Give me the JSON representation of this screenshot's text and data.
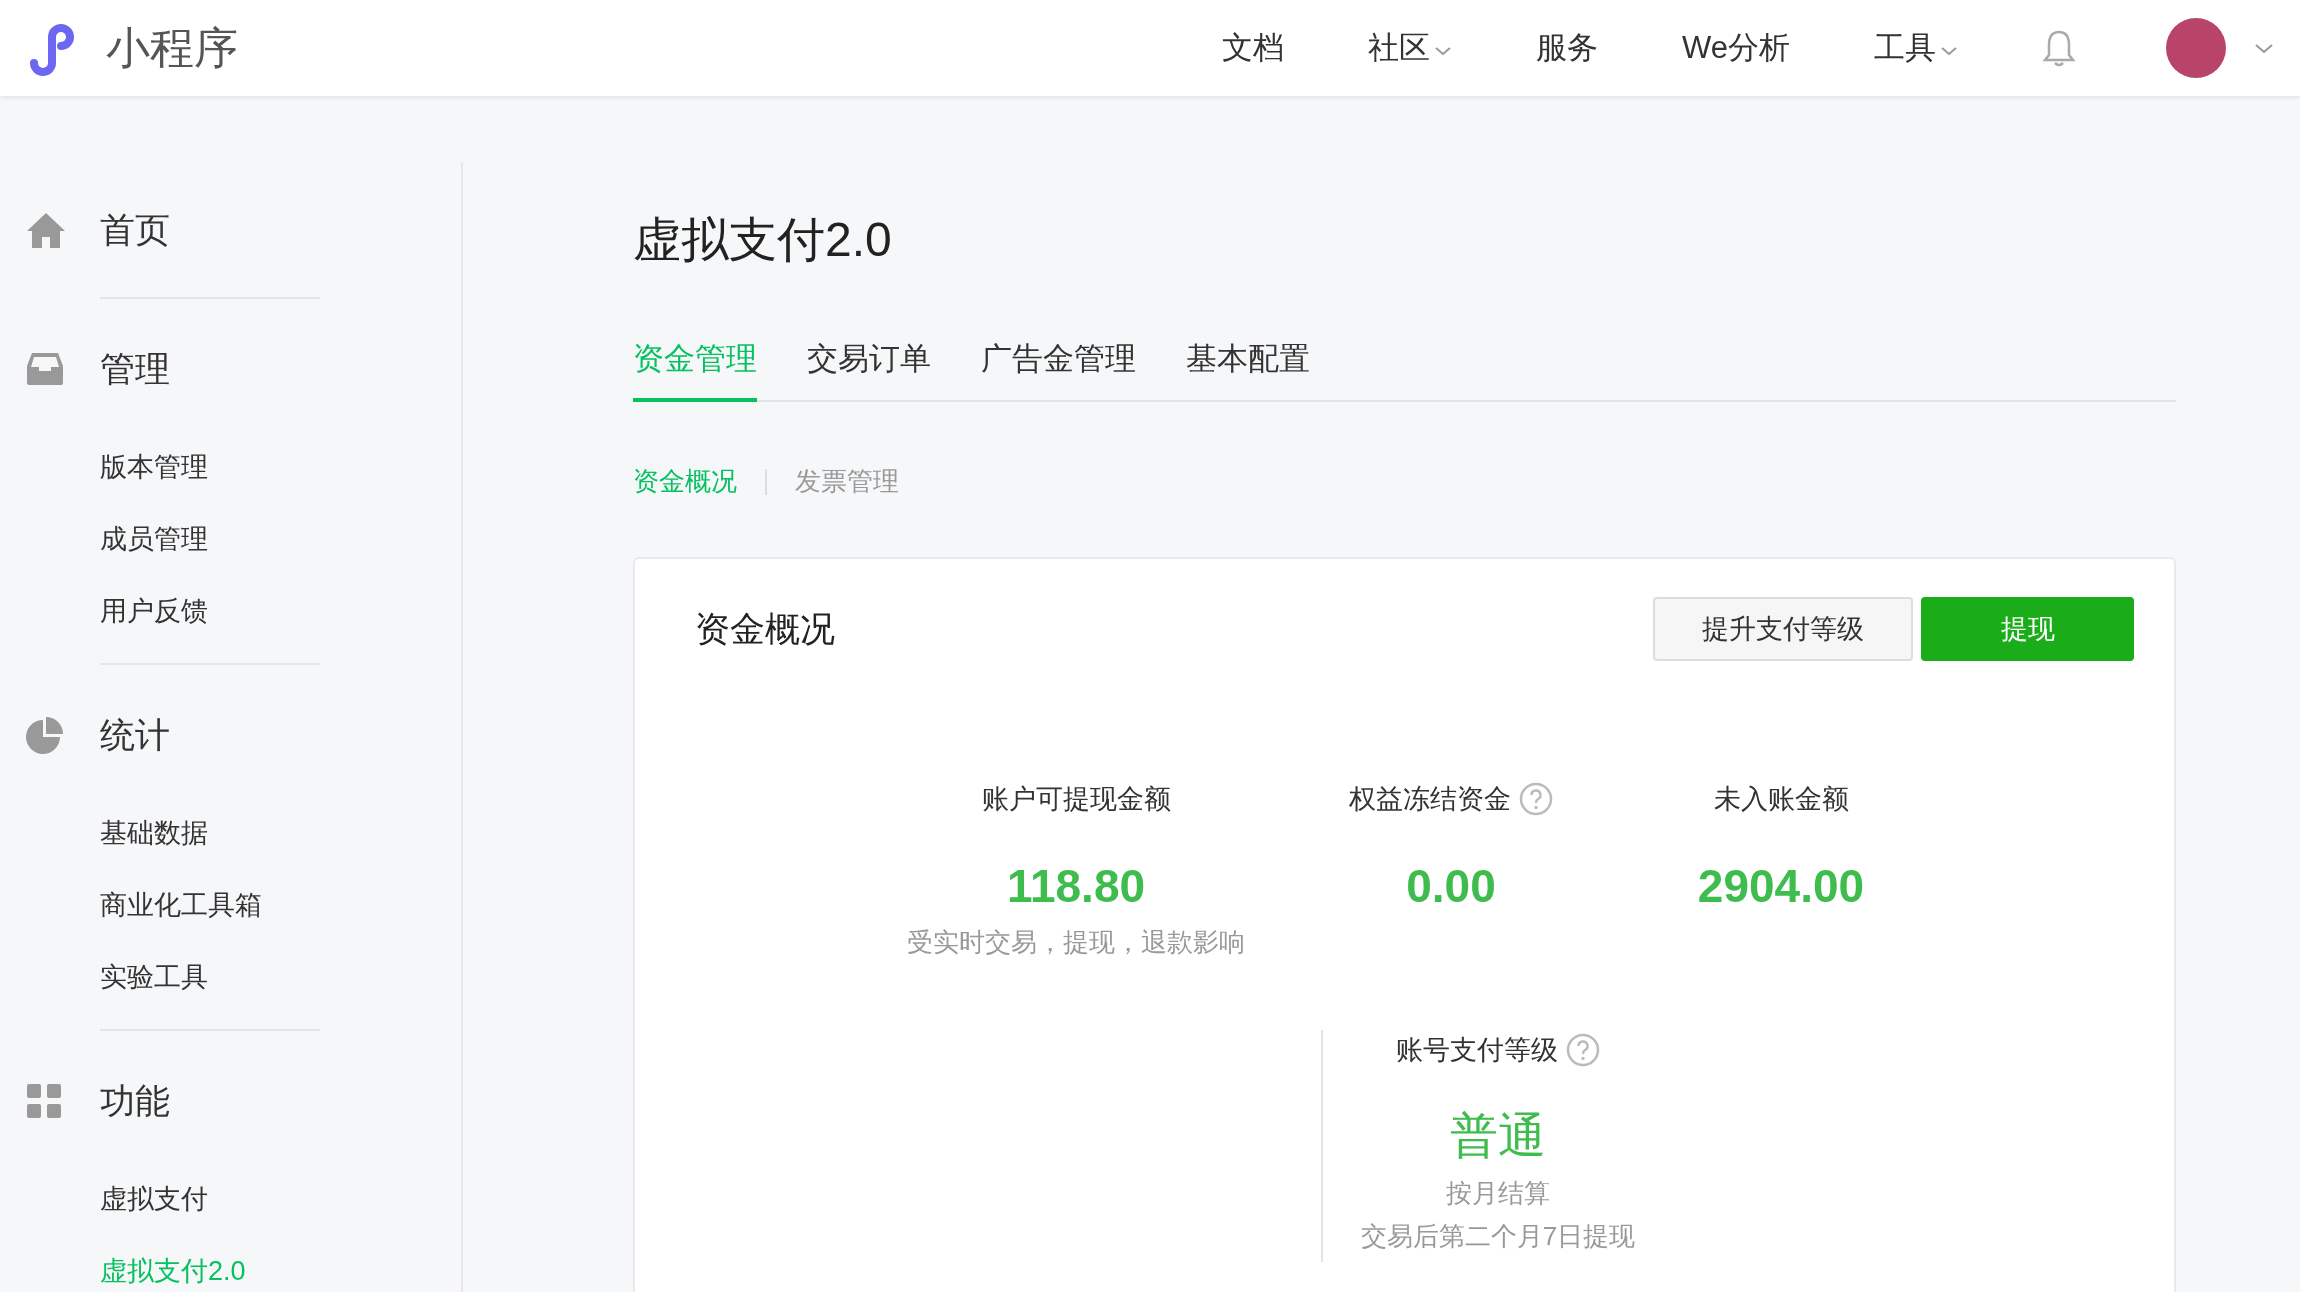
{
  "header": {
    "logo_text": "小程序",
    "nav": [
      {
        "label": "文档",
        "has_menu": false
      },
      {
        "label": "社区",
        "has_menu": true
      },
      {
        "label": "服务",
        "has_menu": false
      },
      {
        "label": "We分析",
        "has_menu": false
      },
      {
        "label": "工具",
        "has_menu": true
      }
    ]
  },
  "sidebar": {
    "sections": [
      {
        "title": "首页"
      },
      {
        "title": "管理",
        "items": [
          {
            "label": "版本管理",
            "selected": false
          },
          {
            "label": "成员管理",
            "selected": false
          },
          {
            "label": "用户反馈",
            "selected": false
          }
        ]
      },
      {
        "title": "统计",
        "items": [
          {
            "label": "基础数据",
            "selected": false
          },
          {
            "label": "商业化工具箱",
            "selected": false
          },
          {
            "label": "实验工具",
            "selected": false
          }
        ]
      },
      {
        "title": "功能",
        "items": [
          {
            "label": "虚拟支付",
            "selected": false
          },
          {
            "label": "虚拟支付2.0",
            "selected": true
          }
        ]
      }
    ]
  },
  "page_title": "虚拟支付2.0",
  "tabs": [
    {
      "label": "资金管理",
      "selected": true
    },
    {
      "label": "交易订单",
      "selected": false
    },
    {
      "label": "广告金管理",
      "selected": false
    },
    {
      "label": "基本配置",
      "selected": false
    }
  ],
  "subtabs": [
    {
      "label": "资金概况",
      "selected": true
    },
    {
      "label": "发票管理",
      "selected": false
    }
  ],
  "card": {
    "title": "资金概况",
    "buttons": [
      {
        "label": "提升支付等级",
        "kind": "secondary"
      },
      {
        "label": "提现",
        "kind": "primary"
      }
    ],
    "stats": [
      {
        "label": "账户可提现金额",
        "help": false,
        "value": "118.80",
        "note": "受实时交易，提现，退款影响"
      },
      {
        "label": "权益冻结资金",
        "help": true,
        "value": "0.00"
      },
      {
        "label": "未入账金额",
        "help": false,
        "value": "2904.00"
      }
    ],
    "level": {
      "label": "账号支付等级",
      "help": true,
      "value": "普通",
      "notes": [
        "按月结算",
        "交易后第二个月7日提现"
      ]
    }
  }
}
